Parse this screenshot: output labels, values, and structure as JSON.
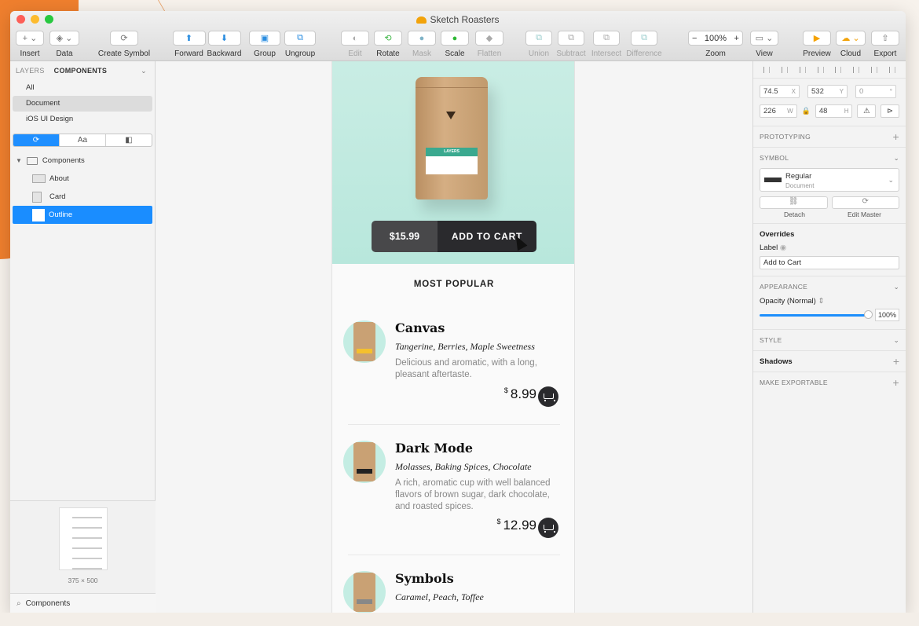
{
  "window": {
    "title": "Sketch Roasters"
  },
  "colors": {
    "accent": "#1a8dff",
    "dark_button": "#2a2a2d",
    "price_bg": "#48484a",
    "mint": "#c4ede3",
    "brand_orange": "#ef7f2e"
  },
  "toolbar": {
    "insert": "Insert",
    "data": "Data",
    "create_symbol": "Create Symbol",
    "forward": "Forward",
    "backward": "Backward",
    "group": "Group",
    "ungroup": "Ungroup",
    "edit": "Edit",
    "rotate": "Rotate",
    "mask": "Mask",
    "scale": "Scale",
    "flatten": "Flatten",
    "union": "Union",
    "subtract": "Subtract",
    "intersect": "Intersect",
    "difference": "Difference",
    "zoom_label": "Zoom",
    "zoom_value": "100%",
    "view": "View",
    "preview": "Preview",
    "cloud": "Cloud",
    "export": "Export"
  },
  "sidebar": {
    "tab_layers": "LAYERS",
    "tab_components": "COMPONENTS",
    "filters": [
      "All",
      "Document",
      "iOS UI Design"
    ],
    "seg_text": "Aa",
    "tree": {
      "folder": "Components",
      "items": [
        "About",
        "Card",
        "Outline"
      ]
    },
    "preview_size": "375 × 500",
    "search_value": "Components"
  },
  "artboard": {
    "hero": {
      "price": "$15.99",
      "cta": "ADD TO CART",
      "bag_label": "LAYERS"
    },
    "section_title": "MOST POPULAR",
    "products": [
      {
        "name": "Canvas",
        "flavors": "Tangerine, Berries, Maple Sweetness",
        "desc": "Delicious and aromatic, with a long, pleasant aftertaste.",
        "currency": "$",
        "price": "8.99"
      },
      {
        "name": "Dark Mode",
        "flavors": "Molasses, Baking Spices, Chocolate",
        "desc": "A rich, aromatic cup with well balanced flavors of brown sugar, dark chocolate, and roasted spices.",
        "currency": "$",
        "price": "12.99"
      },
      {
        "name": "Symbols",
        "flavors": "Caramel, Peach, Toffee",
        "desc": "",
        "currency": "",
        "price": ""
      }
    ]
  },
  "inspector": {
    "x": "74.5",
    "x_unit": "X",
    "y": "532",
    "y_unit": "Y",
    "rot": "0",
    "rot_unit": "°",
    "w": "226",
    "w_unit": "W",
    "h": "48",
    "h_unit": "H",
    "prototyping": "PROTOTYPING",
    "symbol": "SYMBOL",
    "symbol_name": "Regular",
    "symbol_source": "Document",
    "detach": "Detach",
    "edit_master": "Edit Master",
    "overrides": "Overrides",
    "label": "Label",
    "label_value": "Add to Cart",
    "appearance": "APPEARANCE",
    "opacity_label": "Opacity (Normal)",
    "opacity": 1.0,
    "opacity_value": "100%",
    "style": "STYLE",
    "shadows": "Shadows",
    "exportable": "MAKE EXPORTABLE"
  }
}
